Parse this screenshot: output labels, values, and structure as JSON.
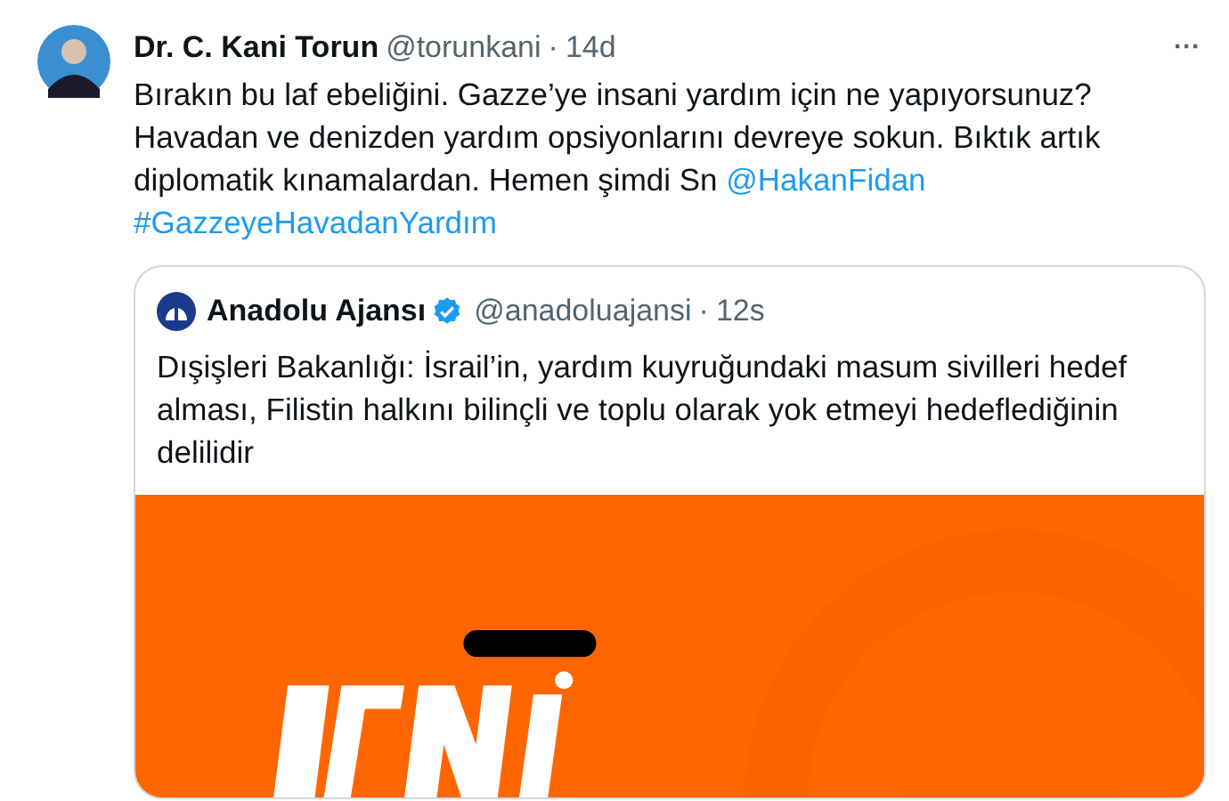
{
  "tweet": {
    "author": {
      "name": "Dr. C. Kani Torun",
      "handle": "@torunkani",
      "separator": "·",
      "time": "14d"
    },
    "more": "···",
    "body": [
      {
        "kind": "text",
        "text": "Bırakın bu laf ebeliğini. Gazze’ye insani yardım için ne yapıyorsunuz? Havadan ve denizden yardım opsiyonlarını devreye sokun. Bıktık artık diplomatik kınamalardan. Hemen şimdi Sn "
      },
      {
        "kind": "mention",
        "text": "@HakanFidan"
      }
    ],
    "hashtag": "#GazzeyeHavadanYardım",
    "quote": {
      "author": {
        "name": "Anadolu Ajansı",
        "verified": true,
        "handle": "@anadoluajansi",
        "separator": "·",
        "time": "12s"
      },
      "text": "Dışişleri Bakanlığı: İsrail’in, yardım kuyruğundaki masum sivilleri hedef alması, Filistin halkını bilinçli ve toplu olarak yok etmeyi hedeflediğinin delilidir"
    }
  }
}
